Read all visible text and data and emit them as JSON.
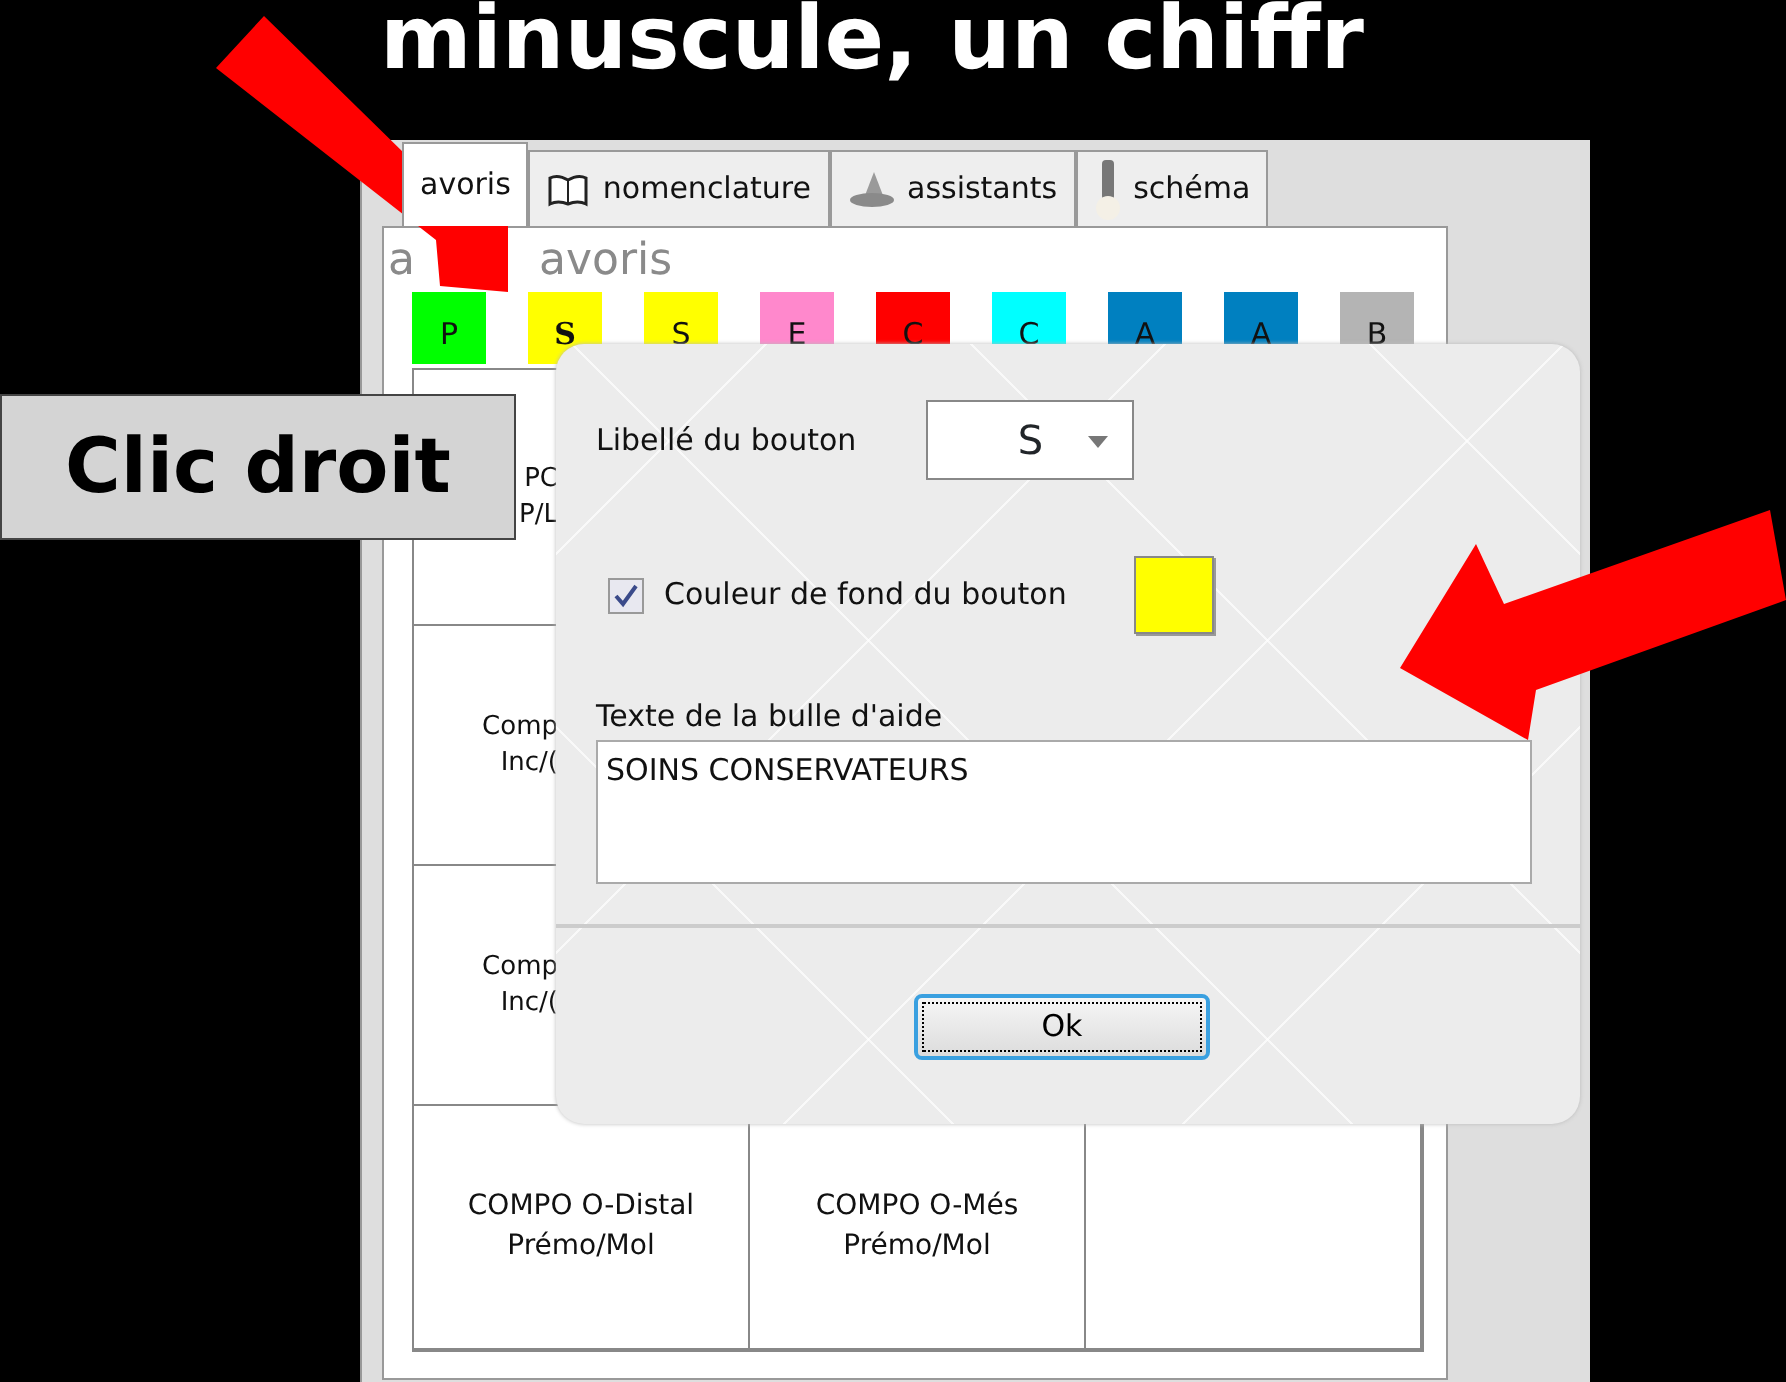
{
  "slide": {
    "title": "minuscule, un chiffr"
  },
  "app": {
    "tabs": [
      {
        "label": "avoris",
        "selected": true
      },
      {
        "label": "nomenclature",
        "selected": false
      },
      {
        "label": "assistants",
        "selected": false
      },
      {
        "label": "schéma",
        "selected": false
      }
    ],
    "heading_fragments": [
      "a",
      "avoris"
    ],
    "color_buttons": [
      {
        "label": "P",
        "color": "#00ff00",
        "selected": false
      },
      {
        "label": "S",
        "color": "#ffff00",
        "selected": true
      },
      {
        "label": "S",
        "color": "#ffff00",
        "selected": false
      },
      {
        "label": "E",
        "color": "#ff88cc",
        "selected": false
      },
      {
        "label": "C",
        "color": "#ff0000",
        "selected": false
      },
      {
        "label": "C",
        "color": "#00ffff",
        "selected": false
      },
      {
        "label": "A",
        "color": "#0080c0",
        "selected": false
      },
      {
        "label": "A",
        "color": "#0080c0",
        "selected": false
      },
      {
        "label": "B",
        "color": "#b4b4b4",
        "selected": false
      }
    ],
    "grid": [
      {
        "cells": [
          {
            "lines": [
              "PC",
              "P/L"
            ],
            "clipped": true
          }
        ]
      },
      {
        "cells": [
          {
            "lines": [
              "Comp",
              "Inc/("
            ],
            "clipped": true
          }
        ]
      },
      {
        "cells": [
          {
            "lines": [
              "Comp",
              "Inc/("
            ],
            "clipped": true
          }
        ]
      },
      {
        "cells": [
          {
            "lines": [
              "COMPO O-Distal",
              "Prémo/Mol"
            ],
            "clipped": false
          },
          {
            "lines": [
              "COMPO O-Més",
              "Prémo/Mol"
            ],
            "clipped": false
          }
        ]
      }
    ]
  },
  "dialog": {
    "label_field": {
      "label": "Libellé du bouton",
      "value": "S"
    },
    "color_option": {
      "label": "Couleur de fond du bouton",
      "checked": true,
      "color": "#ffff00"
    },
    "tooltip_field": {
      "label": "Texte de la bulle d'aide",
      "value": "SOINS CONSERVATEURS"
    },
    "ok_button": "Ok"
  },
  "callout": {
    "text": "Clic droit"
  }
}
